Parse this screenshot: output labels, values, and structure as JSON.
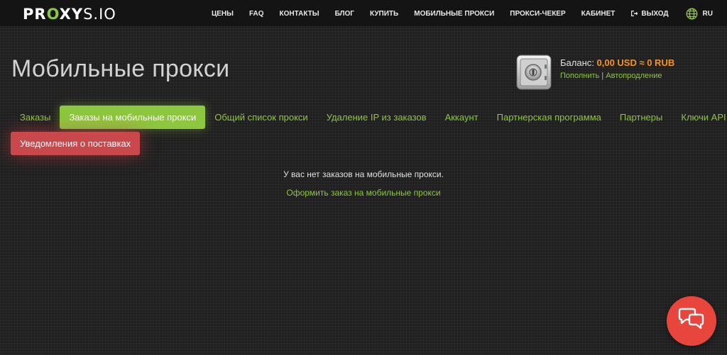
{
  "header": {
    "logo": {
      "part1": "PR",
      "part2": "O",
      "part3": "XY",
      "part4": "S.IO"
    },
    "nav": [
      {
        "label": "ЦЕНЫ"
      },
      {
        "label": "FAQ"
      },
      {
        "label": "КОНТАКТЫ"
      },
      {
        "label": "БЛОГ"
      },
      {
        "label": "КУПИТЬ"
      },
      {
        "label": "МОБИЛЬНЫЕ ПРОКСИ"
      },
      {
        "label": "ПРОКСИ-ЧЕКЕР"
      },
      {
        "label": "КАБИНЕТ"
      },
      {
        "label": "ВЫХОД",
        "icon": "logout-icon"
      },
      {
        "label": "RU",
        "icon": "globe-icon"
      }
    ]
  },
  "page": {
    "title": "Мобильные прокси"
  },
  "balance": {
    "label": "Баланс:",
    "amount": "0,00 USD ≈ 0 RUB",
    "topup": "Пополнить",
    "separator": "|",
    "autorenew": "Автопродление",
    "icon": "safe-icon"
  },
  "tabs": [
    {
      "label": "Заказы",
      "active": false
    },
    {
      "label": "Заказы на мобильные прокси",
      "active": true
    },
    {
      "label": "Общий список прокси",
      "active": false
    },
    {
      "label": "Удаление IP из заказов",
      "active": false
    },
    {
      "label": "Аккаунт",
      "active": false
    },
    {
      "label": "Партнерская программа",
      "active": false
    },
    {
      "label": "Партнеры",
      "active": false
    },
    {
      "label": "Ключи API",
      "active": false
    }
  ],
  "notify_tab": {
    "label": "Уведомления о поставках"
  },
  "content": {
    "empty_message": "У вас нет заказов на мобильные прокси.",
    "order_link": "Оформить заказ на мобильные прокси"
  },
  "chat": {
    "icon": "chat-bubbles-icon"
  },
  "colors": {
    "accent": "#8dc63f",
    "balance": "#f7941d",
    "notify": "#c9484c",
    "chat": "#e8453c"
  }
}
